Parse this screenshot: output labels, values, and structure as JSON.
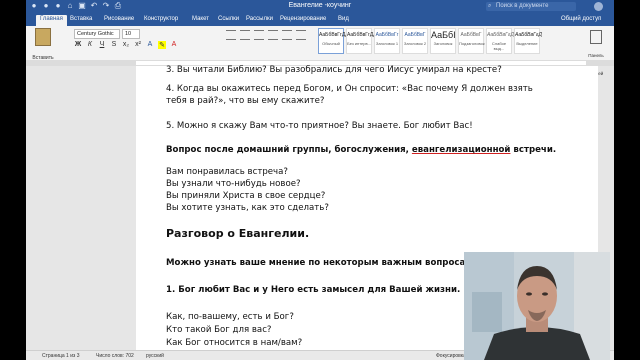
{
  "window": {
    "title": "Евангелие -коучинг",
    "search_placeholder": "Поиск в документе"
  },
  "tabs": [
    "Главная",
    "Вставка",
    "Рисование",
    "Конструктор",
    "Макет",
    "Ссылки",
    "Рассылки",
    "Рецензирование",
    "Вид"
  ],
  "share_label": "Общий доступ",
  "ribbon": {
    "paste_label": "Вставить",
    "font_name": "Century Gothic",
    "font_size": "10",
    "styles": [
      {
        "preview": "АаБбВвГгДд",
        "name": "Обычный"
      },
      {
        "preview": "АаБбВвГгДд",
        "name": "Без интерв..."
      },
      {
        "preview": "АаБбВвГг",
        "name": "Заголовок 1"
      },
      {
        "preview": "АаБбВвГ",
        "name": "Заголовок 2"
      },
      {
        "preview": "АаБбІ",
        "name": "Заголовок"
      },
      {
        "preview": "АаБбВвГ",
        "name": "Подзаголовок"
      },
      {
        "preview": "АаБбВвГгДд",
        "name": "Слабое выд..."
      },
      {
        "preview": "АаБбВвГгД",
        "name": "Выделение"
      }
    ],
    "panel_label": "Панель стилей"
  },
  "document": {
    "p3": "3. Вы читали Библию? Вы разобрались для чего Иисус умирал на кресте?",
    "p4a": "4. Когда вы окажитесь перед Богом, и Он спросит: «Вас почему Я должен взять",
    "p4b": "тебя в рай?», что вы ему скажите?",
    "p5": "5. Можно я скажу Вам что-то приятное? Вы знаете. Бог любит Вас!",
    "q_heading_pre": "Вопрос после домашний группы, богослужения, ",
    "q_heading_ul": "евангелизационной",
    "q_heading_post": " встречи.",
    "q1": "Вам понравилась встреча?",
    "q2": "Вы узнали что-нибудь новое?",
    "q3": "Вы приняли Христа в свое сердце?",
    "q4": "Вы хотите узнать, как это сделать?",
    "h2": "Разговор о Евангелии.",
    "ask": "Можно узнать ваше мнение по некоторым важным вопросам?",
    "point1": "1. Бог любит Вас и у Него есть замысел для Вашей жизни.",
    "l1": "Как, по-вашему, есть и Бог?",
    "l2": "Кто такой Бог для вас?",
    "l3": "Как Бог относится в нам/вам?"
  },
  "status": {
    "page": "Страница 1 из 3",
    "words": "Число слов: 702",
    "lang": "русский",
    "focus": "Фокусировка"
  },
  "colors": {
    "brand": "#2b579a",
    "spell_underline": "#d02020"
  }
}
